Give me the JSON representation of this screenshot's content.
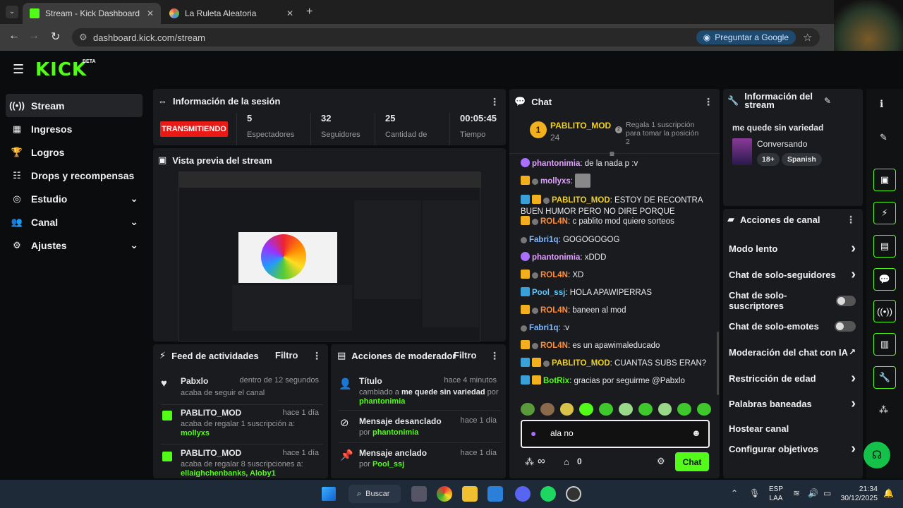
{
  "browser": {
    "tabs": [
      {
        "label": "Stream - Kick Dashboard"
      },
      {
        "label": "La Ruleta Aleatoria"
      }
    ],
    "url": "dashboard.kick.com/stream",
    "google_btn": "Preguntar a Google"
  },
  "brand": {
    "logo": "KICK",
    "beta": "BETA",
    "accent": "#53fc18"
  },
  "sidebar": {
    "items": [
      {
        "label": "Stream"
      },
      {
        "label": "Ingresos"
      },
      {
        "label": "Logros"
      },
      {
        "label": "Drops y recompensas"
      },
      {
        "label": "Estudio"
      },
      {
        "label": "Canal"
      },
      {
        "label": "Ajustes"
      }
    ]
  },
  "session": {
    "title": "Información de la sesión",
    "status": "TRANSMITIENDO",
    "stats": [
      {
        "value": "5",
        "label": "Espectadores"
      },
      {
        "value": "32",
        "label": "Seguidores"
      },
      {
        "value": "25",
        "label": "Cantidad de"
      },
      {
        "value": "00:05:45",
        "label": "Tiempo"
      }
    ]
  },
  "preview": {
    "title": "Vista previa del stream"
  },
  "feed": {
    "title": "Feed de actividades",
    "filter": "Filtro",
    "items": [
      {
        "user": "Pabxlo",
        "time": "dentro de 12 segundos",
        "desc": "acaba de seguir el canal",
        "extra": ""
      },
      {
        "user": "PABLITO_MOD",
        "time": "hace 1 día",
        "desc": "acaba de regalar 1 suscripción a:",
        "extra": "mollyxs"
      },
      {
        "user": "PABLITO_MOD",
        "time": "hace 1 día",
        "desc": "acaba de regalar 8 suscripciones a:",
        "extra": "ellaighchenbanks, Aloby1"
      }
    ]
  },
  "mod": {
    "title": "Acciones de moderador",
    "filter": "Filtro",
    "items": [
      {
        "title": "Título",
        "time": "hace 4 minutos",
        "desc_a": "cambiado a",
        "value": "me quede sin variedad",
        "desc_b": "por",
        "user": "phantonimia"
      },
      {
        "title": "Mensaje desanclado",
        "time": "hace 1 día",
        "desc_a": "por",
        "value": "",
        "desc_b": "",
        "user": "phantonimia"
      },
      {
        "title": "Mensaje anclado",
        "time": "hace 1 día",
        "desc_a": "por",
        "value": "",
        "desc_b": "",
        "user": "Pool_ssj"
      }
    ]
  },
  "chat": {
    "title": "Chat",
    "top_user": "PABLITO_MOD",
    "top_count": "24",
    "top_rank": "1",
    "gift_prompt": "Regala 1 suscripción para tomar la posición 2",
    "gift_rank": "2",
    "messages": [
      {
        "user": "phantonimia",
        "text": "de la nada p :v",
        "color": "#e0a0ff"
      },
      {
        "user": "mollyxs",
        "text": "",
        "color": "#e0a0ff"
      },
      {
        "user": "PABLITO_MOD",
        "text": "ESTOY DE RECONTRA BUEN HUMOR PERO NO DIRE PORQUE",
        "color": "#f2d21e"
      },
      {
        "user": "ROL4N",
        "text": "c pablito mod quiere sorteos",
        "color": "#ff8c3a"
      },
      {
        "user": "Fabri1q",
        "text": "GOGOGOGOG",
        "color": "#7fb8ff"
      },
      {
        "user": "phantonimia",
        "text": "xDDD",
        "color": "#e0a0ff"
      },
      {
        "user": "ROL4N",
        "text": "XD",
        "color": "#ff8c3a"
      },
      {
        "user": "Pool_ssj",
        "text": "HOLA APAWIPERRAS",
        "color": "#5cc8ff"
      },
      {
        "user": "ROL4N",
        "text": "baneen al mod",
        "color": "#ff8c3a"
      },
      {
        "user": "Fabri1q",
        "text": ":v",
        "color": "#7fb8ff"
      },
      {
        "user": "ROL4N",
        "text": "es un apawimaleducado",
        "color": "#ff8c3a"
      },
      {
        "user": "PABLITO_MOD",
        "text": "CUANTAS SUBS ERAN?",
        "color": "#f2d21e"
      },
      {
        "user": "BotRix",
        "text": "gracias por seguirme @Pabxlo",
        "color": "#53fc18"
      }
    ],
    "input_value": "ala no",
    "infinity": "∞",
    "gift_count": "0",
    "send": "Chat"
  },
  "stream_info": {
    "title": "Información del stream",
    "stream_title": "me quede sin variedad",
    "category": "Conversando",
    "tags": [
      "18+",
      "Spanish"
    ]
  },
  "channel_actions": {
    "title": "Acciones de canal",
    "items": [
      {
        "label": "Modo lento",
        "ctrl": "arrow"
      },
      {
        "label": "Chat de solo-seguidores",
        "ctrl": "arrow"
      },
      {
        "label": "Chat de solo-suscriptores",
        "ctrl": "toggle"
      },
      {
        "label": "Chat de solo-emotes",
        "ctrl": "toggle"
      },
      {
        "label": "Moderación del chat con IA",
        "ctrl": "ext"
      },
      {
        "label": "Restricción de edad",
        "ctrl": "arrow"
      },
      {
        "label": "Palabras baneadas",
        "ctrl": "arrow"
      },
      {
        "label": "Hostear canal",
        "ctrl": "none"
      },
      {
        "label": "Configurar objetivos",
        "ctrl": "arrow"
      }
    ]
  },
  "taskbar": {
    "search": "Buscar",
    "lang": "ESP",
    "lang2": "LAA",
    "time": "21:34",
    "date": "30/12/2025"
  },
  "colors": {
    "live": "#e91916",
    "panel": "#191b1f",
    "bg": "#0b0c0d"
  }
}
